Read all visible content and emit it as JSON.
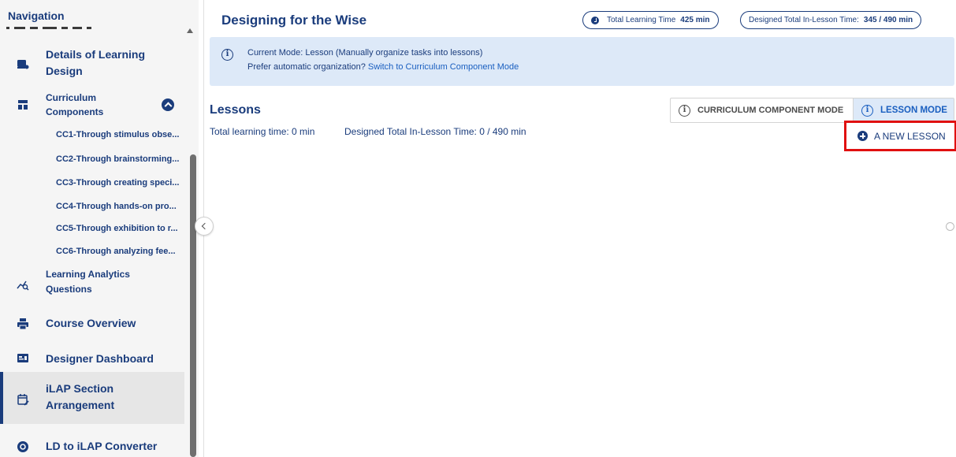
{
  "sidebar": {
    "title": "Navigation",
    "items": {
      "details": {
        "label_line1": "Details of Learning",
        "label_line2": "Design"
      },
      "curriculum": {
        "label_line1": "Curriculum",
        "label_line2": "Components"
      },
      "learning_analytics": {
        "label_line1": "Learning Analytics",
        "label_line2": "Questions"
      },
      "course_overview": {
        "label": "Course Overview"
      },
      "designer_dashboard": {
        "label": "Designer Dashboard"
      },
      "ilap_section": {
        "label_line1": "iLAP Section",
        "label_line2": "Arrangement"
      },
      "ld_converter": {
        "label": "LD to iLAP Converter"
      }
    },
    "sub_items": [
      "CC1-Through stimulus obse...",
      "CC2-Through brainstorming...",
      "CC3-Through creating speci...",
      "CC4-Through hands-on pro...",
      "CC5-Through exhibition to r...",
      "CC6-Through analyzing fee..."
    ]
  },
  "header": {
    "title": "Designing for the Wise",
    "total_learning_label": "Total Learning Time",
    "total_learning_value": "425 min",
    "designed_label": "Designed Total In-Lesson Time:",
    "designed_value": "345 / 490  min"
  },
  "info": {
    "icon": "i",
    "line1": "Current Mode: Lesson (Manually organize tasks into lessons)",
    "line2_prefix": "Prefer automatic organization?",
    "line2_link": "Switch to Curriculum Component Mode"
  },
  "lessons": {
    "heading": "Lessons",
    "total_time": "Total learning time: 0 min",
    "designed_time": "Designed Total In-Lesson Time: 0 / 490 min",
    "mode_curriculum": "CURRICULUM COMPONENT MODE",
    "mode_lesson": "LESSON MODE",
    "new_lesson": "A NEW LESSON"
  },
  "colors": {
    "primary": "#1a3c7c",
    "link": "#1a5fc0",
    "info_bg": "#dde9f8",
    "highlight": "#e01010"
  }
}
